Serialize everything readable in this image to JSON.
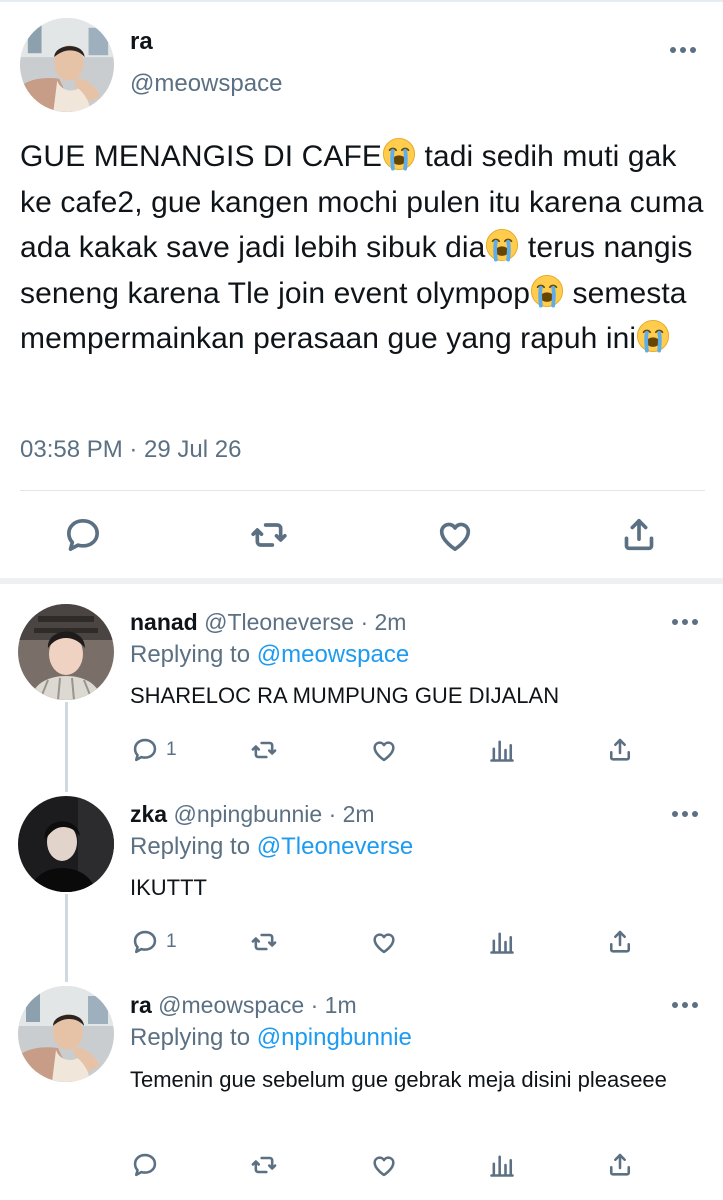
{
  "colors": {
    "text": "#0f1419",
    "muted": "#5b7083",
    "link": "#1d9bf0",
    "divider": "#dfe5ea"
  },
  "main_tweet": {
    "name": "ra",
    "handle": "@meowspace",
    "text_parts": [
      "GUE MENANGIS DI CAFE",
      " tadi sedih muti gak ke cafe2, gue kangen mochi pulen itu karena cuma ada kakak save jadi lebih sibuk dia",
      " terus nangis seneng karena Tle join event olympop",
      " semesta mempermainkan perasaan gue yang rapuh ini"
    ],
    "emoji": "loudly-crying-face-emoji",
    "timestamp": "03:58 PM · 29 Jul 26",
    "actions": [
      "reply-icon",
      "retweet-icon",
      "like-icon",
      "share-icon"
    ]
  },
  "replies": [
    {
      "name": "nanad",
      "handle": "@Tleoneverse",
      "separator": "·",
      "age": "2m",
      "replying_prefix": "Replying to",
      "replying_to": "@meowspace",
      "text": "SHARELOC RA MUMPUNG GUE DIJALAN",
      "reply_count": "1"
    },
    {
      "name": "zka",
      "handle": "@npingbunnie",
      "separator": "·",
      "age": "2m",
      "replying_prefix": "Replying to",
      "replying_to": "@Tleoneverse",
      "text": "IKUTTT",
      "reply_count": "1"
    },
    {
      "name": "ra",
      "handle": "@meowspace",
      "separator": "·",
      "age": "1m",
      "replying_prefix": "Replying to",
      "replying_to": "@npingbunnie",
      "text": "Temenin gue sebelum gue gebrak meja disini pleaseee",
      "reply_count": ""
    }
  ]
}
